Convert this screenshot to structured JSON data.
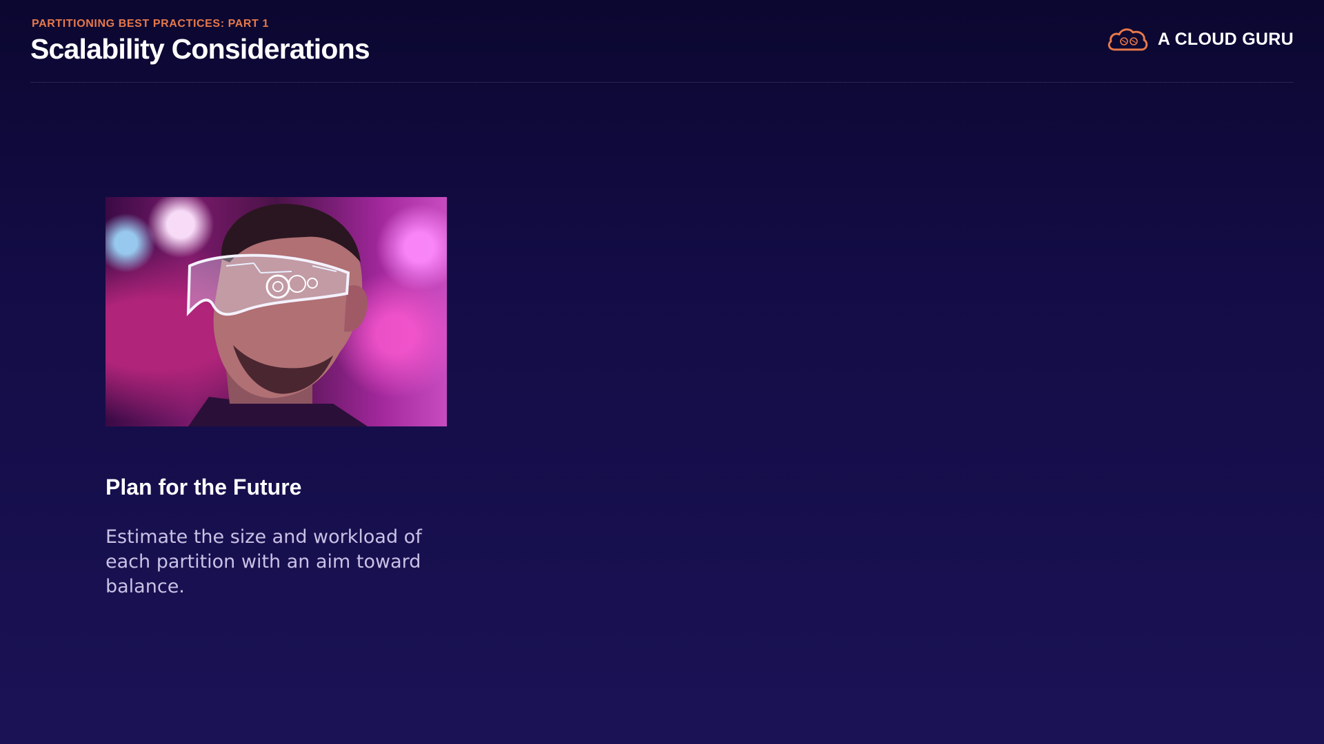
{
  "header": {
    "eyebrow": "PARTITIONING BEST PRACTICES: PART 1",
    "title": "Scalability Considerations",
    "logo_text": "A CLOUD GURU",
    "logo_icon": "cloud-logo-icon"
  },
  "card": {
    "image_icon": "photo-man-with-futuristic-visor",
    "heading": "Plan for the Future",
    "body": "Estimate the size and workload of each partition with an aim toward balance."
  },
  "colors": {
    "background": "#130c45",
    "accent": "#e8794a",
    "body_text": "#c9c2e6"
  }
}
